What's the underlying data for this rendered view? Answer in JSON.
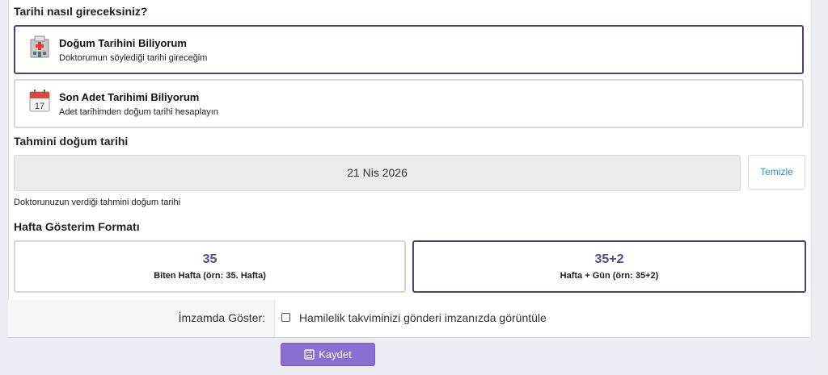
{
  "question": "Tarihi nasıl gireceksiniz?",
  "options": [
    {
      "icon": "hospital-icon",
      "title": "Doğum Tarihini Biliyorum",
      "subtitle": "Doktorumun söylediği tarihi gireceğim",
      "selected": true
    },
    {
      "icon": "calendar-icon",
      "title": "Son Adet Tarihimi Biliyorum",
      "subtitle": "Adet tarihimden doğum tarihi hesaplayın",
      "selected": false
    }
  ],
  "due_date": {
    "heading": "Tahmini doğum tarihi",
    "value": "21 Nis 2026",
    "clear_label": "Temizle",
    "hint": "Doktorunuzun verdiği tahmini doğum tarihi"
  },
  "calendar_icon_day": "17",
  "week_format": {
    "heading": "Hafta Gösterim Formatı",
    "options": [
      {
        "big": "35",
        "small": "Biten Hafta (örn: 35. Hafta)",
        "selected": false
      },
      {
        "big": "35+2",
        "small": "Hafta + Gün (örn: 35+2)",
        "selected": true
      }
    ]
  },
  "signature": {
    "label": "İmzamda Göster:",
    "checkbox_text": "Hamilelik takviminizi gönderi imzanızda görüntüle",
    "checked": false
  },
  "save_label": "Kaydet",
  "colors": {
    "selected_border": "#50406e",
    "accent": "#8b6fd0",
    "link": "#2a8fbd"
  }
}
